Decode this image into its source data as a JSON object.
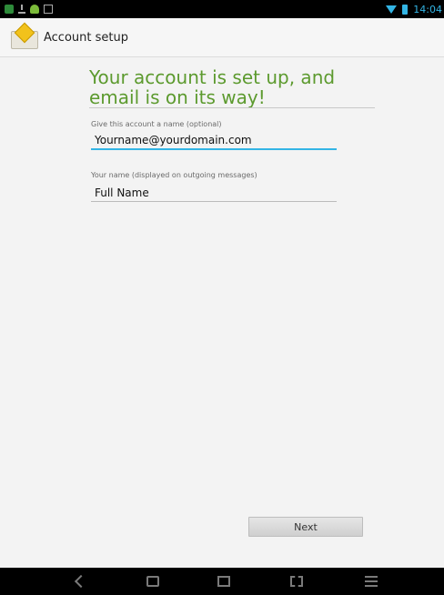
{
  "status_bar": {
    "time": "14:04",
    "icons": [
      "message-icon",
      "download-icon",
      "android-icon",
      "image-icon",
      "wifi-icon",
      "battery-icon"
    ]
  },
  "action_bar": {
    "title": "Account setup",
    "app_icon": "email-app-icon"
  },
  "main": {
    "headline": "Your account is set up, and email is on its way!",
    "account_name_label": "Give this account a name (optional)",
    "account_name_value": "Yourname@yourdomain.com",
    "your_name_label": "Your name (displayed on outgoing messages)",
    "your_name_value": "Full Name"
  },
  "buttons": {
    "next_label": "Next"
  },
  "nav_bar": {
    "icons": [
      "back-icon",
      "home-icon",
      "recent-apps-icon",
      "screenshot-icon",
      "menu-icon"
    ]
  },
  "colors": {
    "accent": "#33b5e5",
    "headline": "#5c9a2e",
    "status_bar": "#000000"
  }
}
